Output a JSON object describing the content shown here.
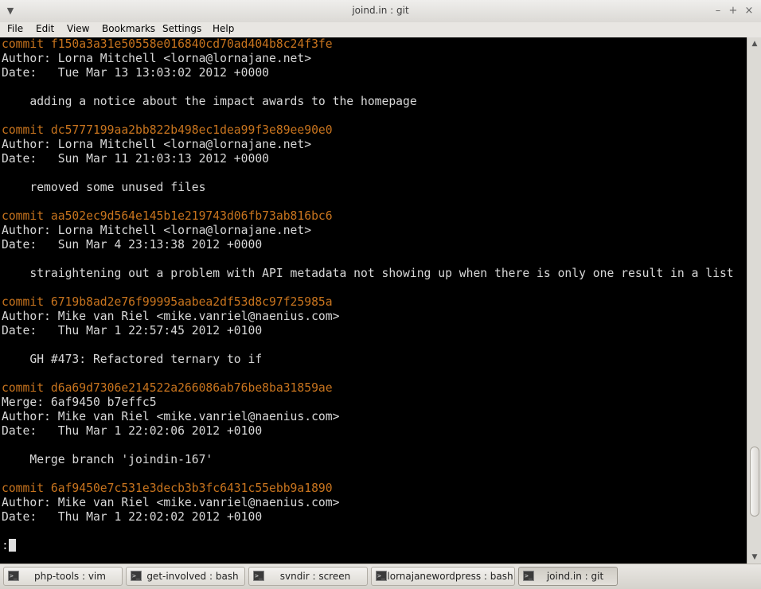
{
  "window": {
    "title": "joind.in : git"
  },
  "menubar": {
    "items": [
      "File",
      "Edit",
      "View",
      "Bookmarks",
      "Settings",
      "Help"
    ]
  },
  "terminal": {
    "lines": [
      {
        "kind": "commit",
        "text": "commit f150a3a31e50558e016840cd70ad404b8c24f3fe"
      },
      {
        "kind": "text",
        "text": "Author: Lorna Mitchell <lorna@lornajane.net>"
      },
      {
        "kind": "text",
        "text": "Date:   Tue Mar 13 13:03:02 2012 +0000"
      },
      {
        "kind": "text",
        "text": ""
      },
      {
        "kind": "text",
        "text": "    adding a notice about the impact awards to the homepage"
      },
      {
        "kind": "text",
        "text": ""
      },
      {
        "kind": "commit",
        "text": "commit dc5777199aa2bb822b498ec1dea99f3e89ee90e0"
      },
      {
        "kind": "text",
        "text": "Author: Lorna Mitchell <lorna@lornajane.net>"
      },
      {
        "kind": "text",
        "text": "Date:   Sun Mar 11 21:03:13 2012 +0000"
      },
      {
        "kind": "text",
        "text": ""
      },
      {
        "kind": "text",
        "text": "    removed some unused files"
      },
      {
        "kind": "text",
        "text": ""
      },
      {
        "kind": "commit",
        "text": "commit aa502ec9d564e145b1e219743d06fb73ab816bc6"
      },
      {
        "kind": "text",
        "text": "Author: Lorna Mitchell <lorna@lornajane.net>"
      },
      {
        "kind": "text",
        "text": "Date:   Sun Mar 4 23:13:38 2012 +0000"
      },
      {
        "kind": "text",
        "text": ""
      },
      {
        "kind": "text",
        "text": "    straightening out a problem with API metadata not showing up when there is only one result in a list"
      },
      {
        "kind": "text",
        "text": ""
      },
      {
        "kind": "commit",
        "text": "commit 6719b8ad2e76f99995aabea2df53d8c97f25985a"
      },
      {
        "kind": "text",
        "text": "Author: Mike van Riel <mike.vanriel@naenius.com>"
      },
      {
        "kind": "text",
        "text": "Date:   Thu Mar 1 22:57:45 2012 +0100"
      },
      {
        "kind": "text",
        "text": ""
      },
      {
        "kind": "text",
        "text": "    GH #473: Refactored ternary to if"
      },
      {
        "kind": "text",
        "text": ""
      },
      {
        "kind": "commit",
        "text": "commit d6a69d7306e214522a266086ab76be8ba31859ae"
      },
      {
        "kind": "text",
        "text": "Merge: 6af9450 b7effc5"
      },
      {
        "kind": "text",
        "text": "Author: Mike van Riel <mike.vanriel@naenius.com>"
      },
      {
        "kind": "text",
        "text": "Date:   Thu Mar 1 22:02:06 2012 +0100"
      },
      {
        "kind": "text",
        "text": ""
      },
      {
        "kind": "text",
        "text": "    Merge branch 'joindin-167'"
      },
      {
        "kind": "text",
        "text": ""
      },
      {
        "kind": "commit",
        "text": "commit 6af9450e7c531e3decb3b3fc6431c55ebb9a1890"
      },
      {
        "kind": "text",
        "text": "Author: Mike van Riel <mike.vanriel@naenius.com>"
      },
      {
        "kind": "text",
        "text": "Date:   Thu Mar 1 22:02:02 2012 +0100"
      },
      {
        "kind": "text",
        "text": ""
      },
      {
        "kind": "prompt",
        "text": ":"
      }
    ],
    "colors": {
      "background": "#000000",
      "text": "#d8d8d8",
      "commit": "#c8741e"
    }
  },
  "scrollbar": {
    "position": 0.92,
    "visible_fraction": 0.14
  },
  "taskbar": {
    "tasks": [
      {
        "label": "php-tools : vim",
        "icon": "terminal-icon",
        "active": false
      },
      {
        "label": "get-involved : bash",
        "icon": "terminal-icon",
        "active": false
      },
      {
        "label": "svndir : screen",
        "icon": "terminal-icon",
        "active": false
      },
      {
        "label": "lornajanewordpress : bash",
        "icon": "terminal-icon",
        "active": false
      },
      {
        "label": "joind.in : git",
        "icon": "terminal-icon",
        "active": true
      }
    ]
  }
}
